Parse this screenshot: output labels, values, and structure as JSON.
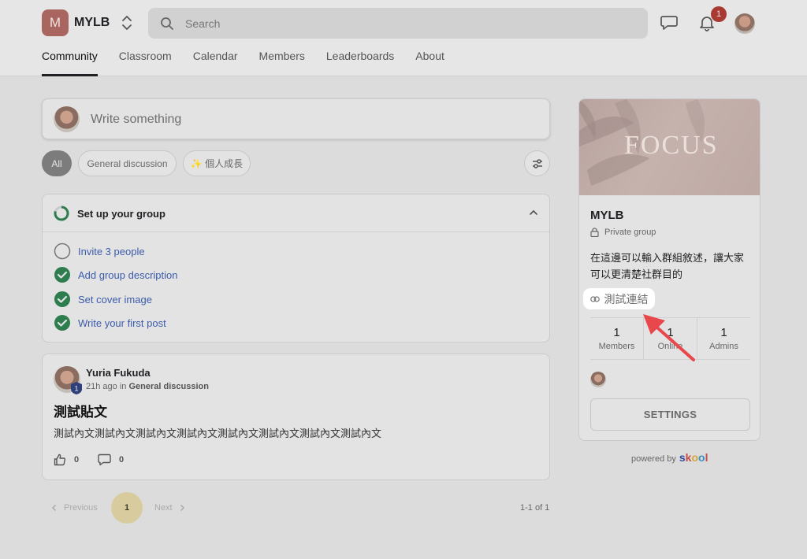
{
  "header": {
    "logo_letter": "M",
    "group_name": "MYLB",
    "search_placeholder": "Search",
    "notification_count": "1"
  },
  "tabs": [
    {
      "label": "Community",
      "active": true
    },
    {
      "label": "Classroom"
    },
    {
      "label": "Calendar"
    },
    {
      "label": "Members"
    },
    {
      "label": "Leaderboards"
    },
    {
      "label": "About"
    }
  ],
  "composer": {
    "placeholder": "Write something"
  },
  "filters": [
    "All",
    "General discussion",
    "✨ 個人成長"
  ],
  "setup": {
    "title": "Set up your group",
    "tasks": [
      {
        "label": "Invite 3 people",
        "done": false
      },
      {
        "label": "Add group description",
        "done": true
      },
      {
        "label": "Set cover image",
        "done": true
      },
      {
        "label": "Write your first post",
        "done": true
      }
    ]
  },
  "post": {
    "author": "Yuria Fukuda",
    "level": "1",
    "time": "21h ago in",
    "category": "General discussion",
    "title": "測試貼文",
    "body": "測試內文測試內文測試內文測試內文測試內文測試內文測試內文測試內文",
    "likes": "0",
    "comments": "0"
  },
  "pagination": {
    "previous": "Previous",
    "current": "1",
    "next": "Next",
    "range": "1-1 of 1"
  },
  "sidebar": {
    "cover_text": "FOCUS",
    "name": "MYLB",
    "privacy": "Private group",
    "description": "在這邊可以輸入群組敘述，讓大家可以更清楚社群目的",
    "link": "測試連結",
    "stats": [
      {
        "value": "1",
        "label": "Members"
      },
      {
        "value": "1",
        "label": "Online"
      },
      {
        "value": "1",
        "label": "Admins"
      }
    ],
    "settings": "SETTINGS"
  },
  "footer": {
    "powered_by": "powered by",
    "brand": "skool"
  },
  "colors": {
    "accent_green": "#2e7d4f",
    "link_blue": "#3b5bab",
    "badge_red": "#a83a33",
    "annotation_arrow": "#e8474c"
  }
}
